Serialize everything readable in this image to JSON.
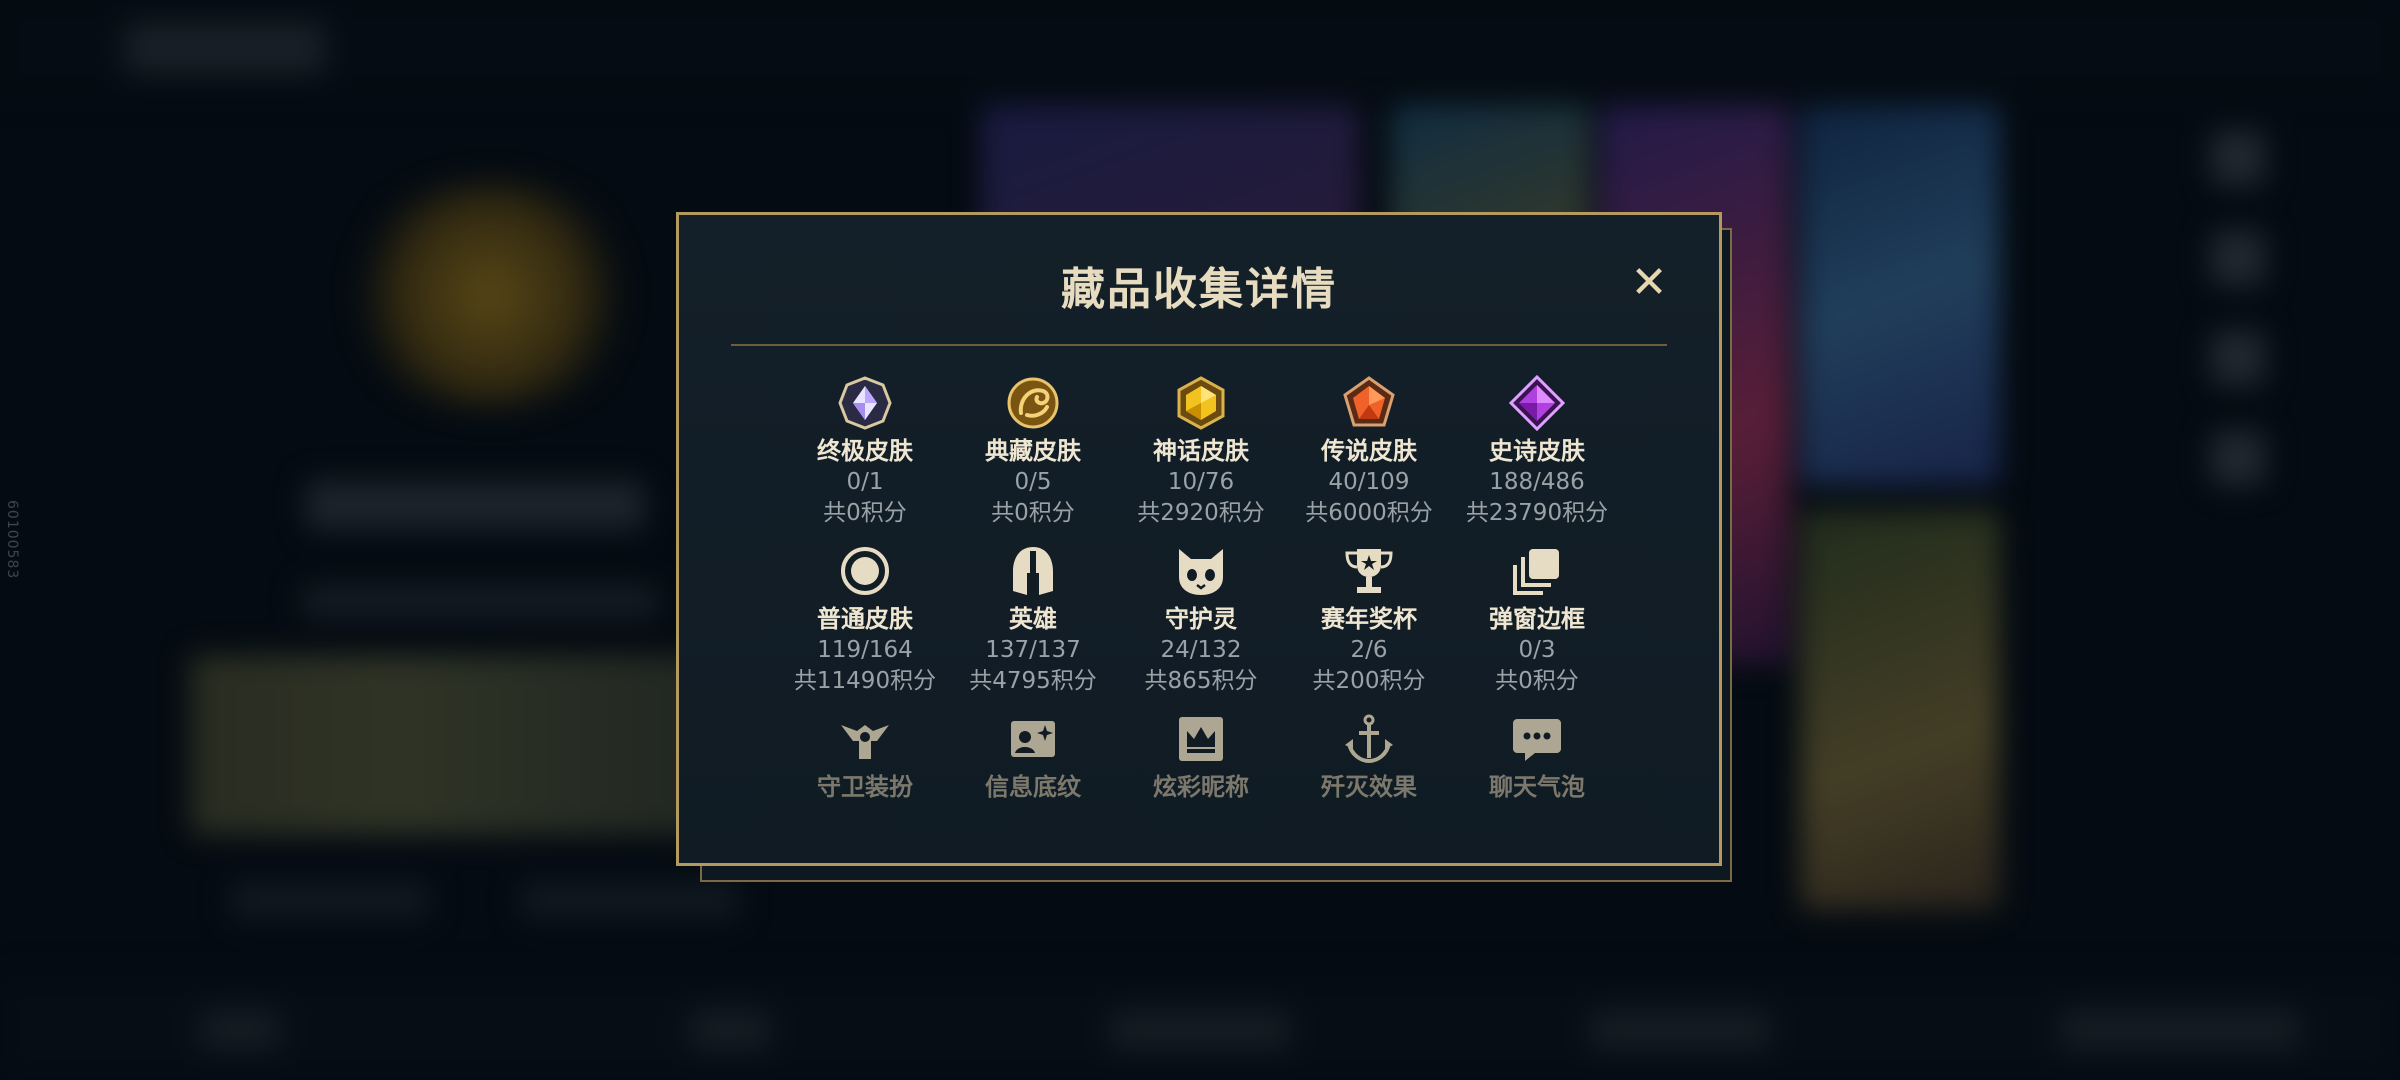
{
  "side_code": "60100583",
  "modal": {
    "title": "藏品收集详情",
    "close_symbol": "✕",
    "rows": [
      [
        {
          "name": "终极皮肤",
          "count": "0/1",
          "points": "共0积分",
          "icon": "ultimate-gem-icon"
        },
        {
          "name": "典藏皮肤",
          "count": "0/5",
          "points": "共0积分",
          "icon": "prestige-dragon-icon"
        },
        {
          "name": "神话皮肤",
          "count": "10/76",
          "points": "共2920积分",
          "icon": "mythic-gem-icon"
        },
        {
          "name": "传说皮肤",
          "count": "40/109",
          "points": "共6000积分",
          "icon": "legendary-gem-icon"
        },
        {
          "name": "史诗皮肤",
          "count": "188/486",
          "points": "共23790积分",
          "icon": "epic-gem-icon"
        }
      ],
      [
        {
          "name": "普通皮肤",
          "count": "119/164",
          "points": "共11490积分",
          "icon": "standard-ring-icon"
        },
        {
          "name": "英雄",
          "count": "137/137",
          "points": "共4795积分",
          "icon": "champion-helmet-icon"
        },
        {
          "name": "守护灵",
          "count": "24/132",
          "points": "共865积分",
          "icon": "ward-creature-icon"
        },
        {
          "name": "赛年奖杯",
          "count": "2/6",
          "points": "共200积分",
          "icon": "trophy-icon"
        },
        {
          "name": "弹窗边框",
          "count": "0/3",
          "points": "共0积分",
          "icon": "frame-stack-icon"
        }
      ],
      [
        {
          "name": "守卫装扮",
          "icon": "ward-skin-icon"
        },
        {
          "name": "信息底纹",
          "icon": "banner-card-icon"
        },
        {
          "name": "炫彩昵称",
          "icon": "crown-nameplate-icon"
        },
        {
          "name": "歼灭效果",
          "icon": "anchor-icon"
        },
        {
          "name": "聊天气泡",
          "icon": "chat-bubble-icon"
        }
      ]
    ]
  }
}
